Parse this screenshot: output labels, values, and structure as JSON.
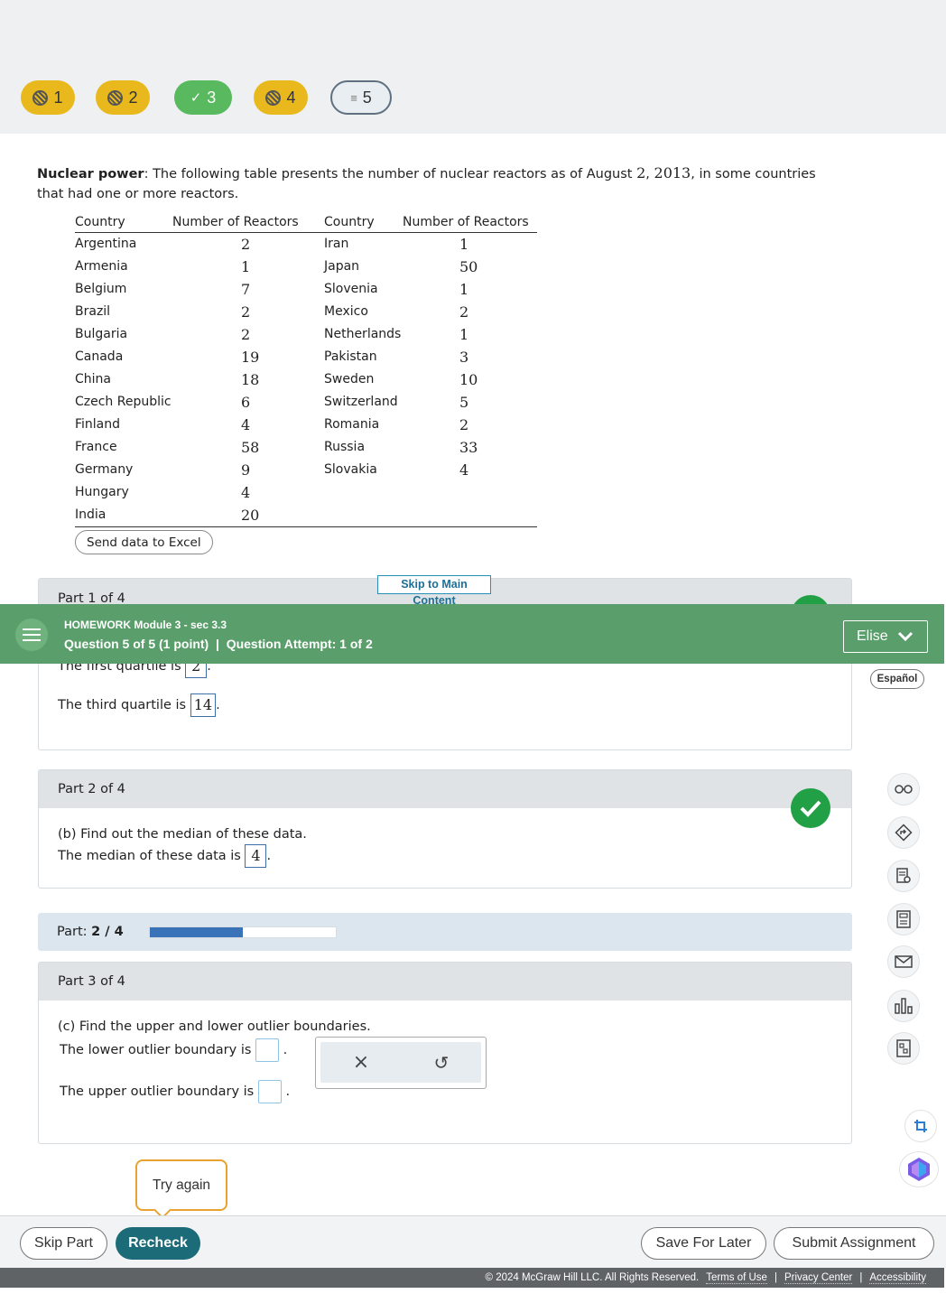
{
  "nav": {
    "pills": [
      {
        "num": "1",
        "state": "partial"
      },
      {
        "num": "2",
        "state": "partial"
      },
      {
        "num": "3",
        "state": "complete"
      },
      {
        "num": "4",
        "state": "partial"
      },
      {
        "num": "5",
        "state": "current"
      }
    ]
  },
  "question": {
    "topic": "Nuclear power",
    "intro": ": The following table presents the number of nuclear reactors as of August ",
    "date_day": "2",
    "date_sep": ", ",
    "date_year": "2013",
    "intro_end": ", in some countries that had one or more reactors."
  },
  "table": {
    "headers": [
      "Country",
      "Number of Reactors",
      "Country",
      "Number of Reactors"
    ],
    "rows": [
      [
        "Argentina",
        "2",
        "Iran",
        "1"
      ],
      [
        "Armenia",
        "1",
        "Japan",
        "50"
      ],
      [
        "Belgium",
        "7",
        "Slovenia",
        "1"
      ],
      [
        "Brazil",
        "2",
        "Mexico",
        "2"
      ],
      [
        "Bulgaria",
        "2",
        "Netherlands",
        "1"
      ],
      [
        "Canada",
        "19",
        "Pakistan",
        "3"
      ],
      [
        "China",
        "18",
        "Sweden",
        "10"
      ],
      [
        "Czech Republic",
        "6",
        "Switzerland",
        "5"
      ],
      [
        "Finland",
        "4",
        "Romania",
        "2"
      ],
      [
        "France",
        "58",
        "Russia",
        "33"
      ],
      [
        "Germany",
        "9",
        "Slovakia",
        "4"
      ],
      [
        "Hungary",
        "4",
        "",
        ""
      ],
      [
        "India",
        "20",
        "",
        ""
      ]
    ],
    "excel_button": "Send data to Excel"
  },
  "skip_link": "Skip to Main Content",
  "header": {
    "title": "HOMEWORK Module 3 - sec 3.3",
    "subtitle": "Question 5 of 5 (1 point)  |  Question Attempt: 1 of 2",
    "user": "Elise"
  },
  "language_button": "Español",
  "part1": {
    "label": "Part 1 of 4",
    "first_quartile_text": "The first quartile is",
    "first_quartile_value": "2",
    "third_quartile_text": "The third quartile is",
    "third_quartile_value": "14"
  },
  "part2": {
    "label": "Part 2 of 4",
    "prompt": "(b) Find out the median of these data.",
    "median_text": "The median of these data is",
    "median_value": "4"
  },
  "progress": {
    "label": "Part:",
    "value": "2 / 4",
    "fraction": 0.5
  },
  "part3": {
    "label": "Part 3 of 4",
    "prompt": "(c) Find the upper and lower outlier boundaries.",
    "lower_text": "The lower outlier boundary is",
    "upper_text": "The upper outlier boundary is"
  },
  "popup": {
    "clear": "×",
    "undo": "↺"
  },
  "try_again": "Try again",
  "footer": {
    "skip": "Skip Part",
    "recheck": "Recheck",
    "save": "Save For Later",
    "submit": "Submit Assignment"
  },
  "copyright": {
    "text": "© 2024 McGraw Hill LLC. All Rights Reserved.",
    "terms": "Terms of Use",
    "privacy": "Privacy Center",
    "accessibility": "Accessibility",
    "sep": "|"
  }
}
